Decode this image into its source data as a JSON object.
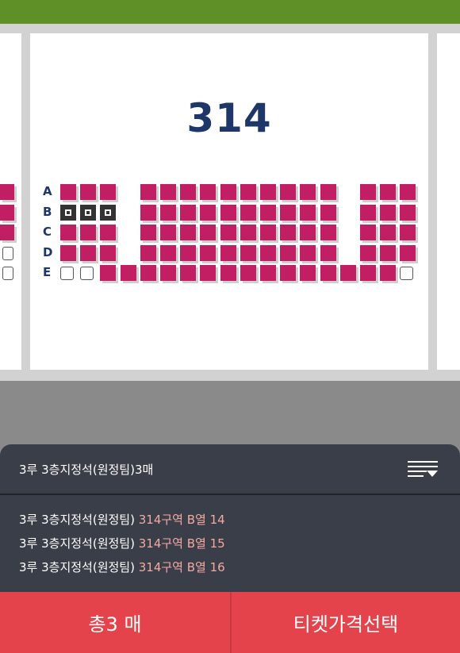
{
  "section": {
    "number": "314"
  },
  "rows": [
    "A",
    "B",
    "C",
    "D",
    "E"
  ],
  "seat_map": {
    "A": [
      "a",
      "a",
      "a",
      "-",
      "a",
      "a",
      "a",
      "a",
      "a",
      "a",
      "a",
      "a",
      "a",
      "a",
      "-",
      "a",
      "a",
      "a"
    ],
    "B": [
      "s",
      "s",
      "s",
      "-",
      "a",
      "a",
      "a",
      "a",
      "a",
      "a",
      "a",
      "a",
      "a",
      "a",
      "-",
      "a",
      "a",
      "a"
    ],
    "C": [
      "a",
      "a",
      "a",
      "-",
      "a",
      "a",
      "a",
      "a",
      "a",
      "a",
      "a",
      "a",
      "a",
      "a",
      "-",
      "a",
      "a",
      "a"
    ],
    "D": [
      "a",
      "a",
      "a",
      "-",
      "a",
      "a",
      "a",
      "a",
      "a",
      "a",
      "a",
      "a",
      "a",
      "a",
      "-",
      "a",
      "a",
      "a"
    ],
    "E": [
      "e",
      "e",
      "a",
      "a",
      "a",
      "a",
      "a",
      "a",
      "a",
      "a",
      "a",
      "a",
      "a",
      "a",
      "a",
      "a",
      "a",
      "e"
    ]
  },
  "seat_legend": {
    "a": "available",
    "s": "selected",
    "e": "empty",
    "-": "aisle"
  },
  "colors": {
    "available_seat": "#c21e63",
    "selected_seat": "#333333",
    "accent_red": "#e4434b",
    "price_highlight": "#f4a9a2",
    "sheet_bg": "#3a3e48",
    "top_bar": "#5f8f27"
  },
  "summary": {
    "title": "3루 3층지정석(원정팀)3매",
    "menu_icon": "list-collapse-icon",
    "items": [
      {
        "zone": "3루 3층지정석(원정팀)",
        "detail": "314구역 B열 14"
      },
      {
        "zone": "3루 3층지정석(원정팀)",
        "detail": "314구역 B열 15"
      },
      {
        "zone": "3루 3층지정석(원정팀)",
        "detail": "314구역 B열 16"
      }
    ]
  },
  "footer": {
    "total_label": "총3 매",
    "select_price_label": "티켓가격선택"
  }
}
